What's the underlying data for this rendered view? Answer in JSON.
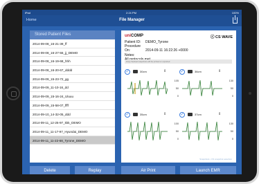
{
  "status": {
    "carrier": "iPad",
    "time": "2:24 PM",
    "battery": "100%"
  },
  "nav": {
    "home": "Home",
    "title": "File Manager"
  },
  "files": {
    "header": "Stored Patient Files",
    "items": [
      {
        "label": "2014-09-08_16-21-39_ff"
      },
      {
        "label": "2014-09-08_16-27-55_jj_DEMO"
      },
      {
        "label": "2014-09-08_16-19-68_hhh"
      },
      {
        "label": "2014-09-08_16-20-67_dddd"
      },
      {
        "label": "2014-09-09_15-23-72_gg"
      },
      {
        "label": "2014-09-09_11-10-16_dd"
      },
      {
        "label": "2014-09-09_15-16-24_Uluuu"
      },
      {
        "label": "2014-09-09_15-58-07_ffff"
      },
      {
        "label": "2014-09-10_14-32-05_ddd"
      },
      {
        "label": "2014-09-11_12-25-97_kkk_DEMO"
      },
      {
        "label": "2014-09-11_11-17-97_Hyundai_DEMO"
      },
      {
        "label": "2014-09-11_11-22-68_Tyrone_DEMO"
      }
    ],
    "selected_index": 11
  },
  "report": {
    "brand_prefix": "uni",
    "brand_name": "COMP",
    "product": "CS WAVE",
    "patient_label": "Patient ID:",
    "patient_value": "DEMO_Tyrone",
    "procedure_label": "Procedure On:",
    "procedure_value": "2014-09-11 16:22:26 +0000",
    "notes_label": "Notes:",
    "notes_value": "All protocols met.",
    "warning": "Only checked snapshots will be printed or exported",
    "tiles": [
      {
        "label": "30cm",
        "scale": [
          "105",
          "50",
          "0"
        ]
      },
      {
        "label": "36cm",
        "scale": [
          "130",
          "50",
          "0"
        ]
      },
      {
        "label": "35cm",
        "scale": [
          "100",
          "50",
          "0"
        ]
      },
      {
        "label": "37cm",
        "scale": [
          "130",
          "50",
          "0"
        ]
      }
    ],
    "footer": "Snapshots • CS snapshot selection"
  },
  "buttons": {
    "delete": "Delete",
    "replay": "Replay",
    "air_print": "Air Print",
    "launch_emr": "Launch EMR"
  },
  "colors": {
    "screen_bg": "#2b63b0",
    "button": "#5c88cc",
    "accent_red": "#c01e2e",
    "check_blue": "#3b7de0"
  }
}
